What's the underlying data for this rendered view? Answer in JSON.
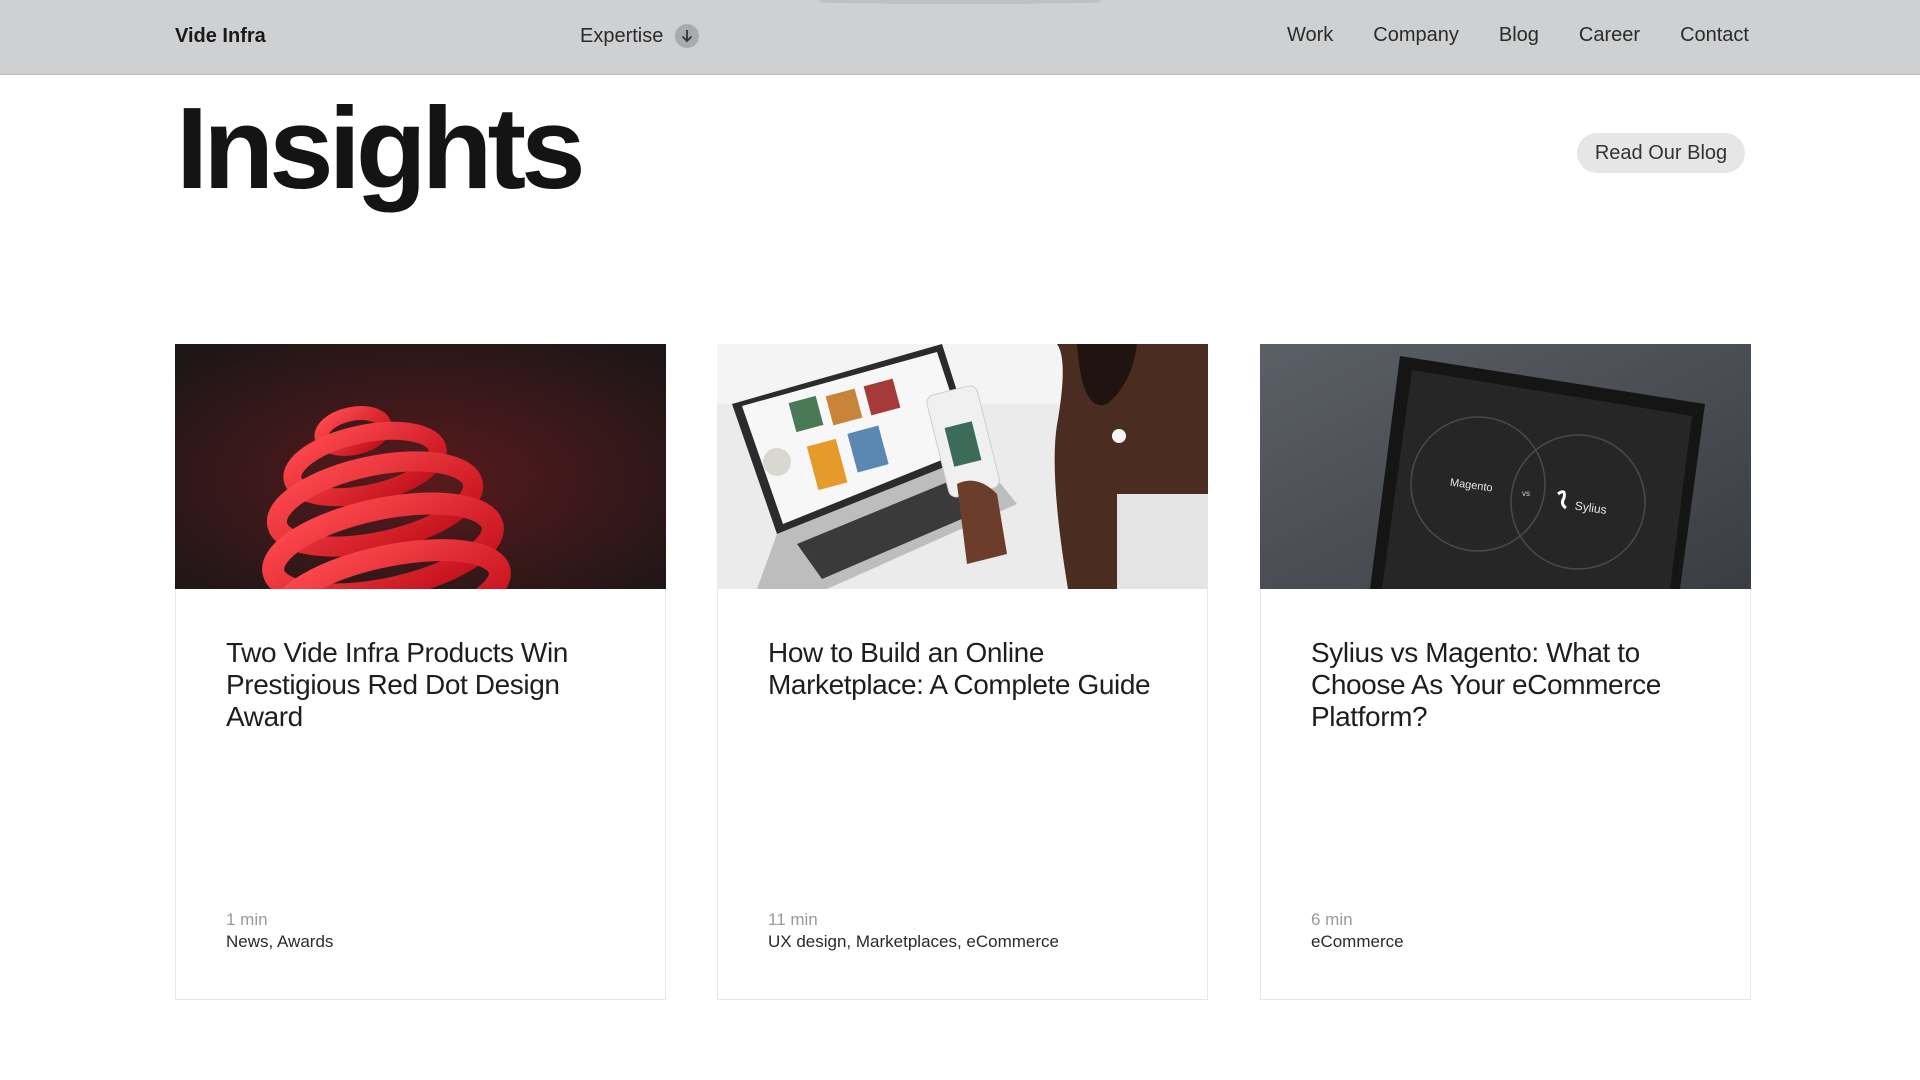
{
  "header": {
    "brand": "Vide Infra",
    "expertise_label": "Expertise",
    "nav": [
      "Work",
      "Company",
      "Blog",
      "Career",
      "Contact"
    ]
  },
  "main": {
    "title": "Insights",
    "read_blog_label": "Read Our Blog",
    "cards": [
      {
        "title": "Two Vide Infra Products Win Prestigious Red Dot Design Award",
        "time": "1 min",
        "tags": "News, Awards",
        "image": "red-dot-sphere"
      },
      {
        "title": "How to Build an Online Marketplace: A Complete Guide",
        "time": "11 min",
        "tags": "UX design, Marketplaces, eCommerce",
        "image": "laptop-phone-marketplace"
      },
      {
        "title": "Sylius vs Magento: What to Choose As Your eCommerce Platform?",
        "time": "6 min",
        "tags": "eCommerce",
        "image": "laptop-magento-vs-sylius",
        "image_text": {
          "left": "Magento",
          "vs": "vs",
          "right": "Sylius"
        }
      }
    ]
  },
  "colors": {
    "header_bg": "#cfd0d2",
    "accent_red": "#e8202a"
  }
}
